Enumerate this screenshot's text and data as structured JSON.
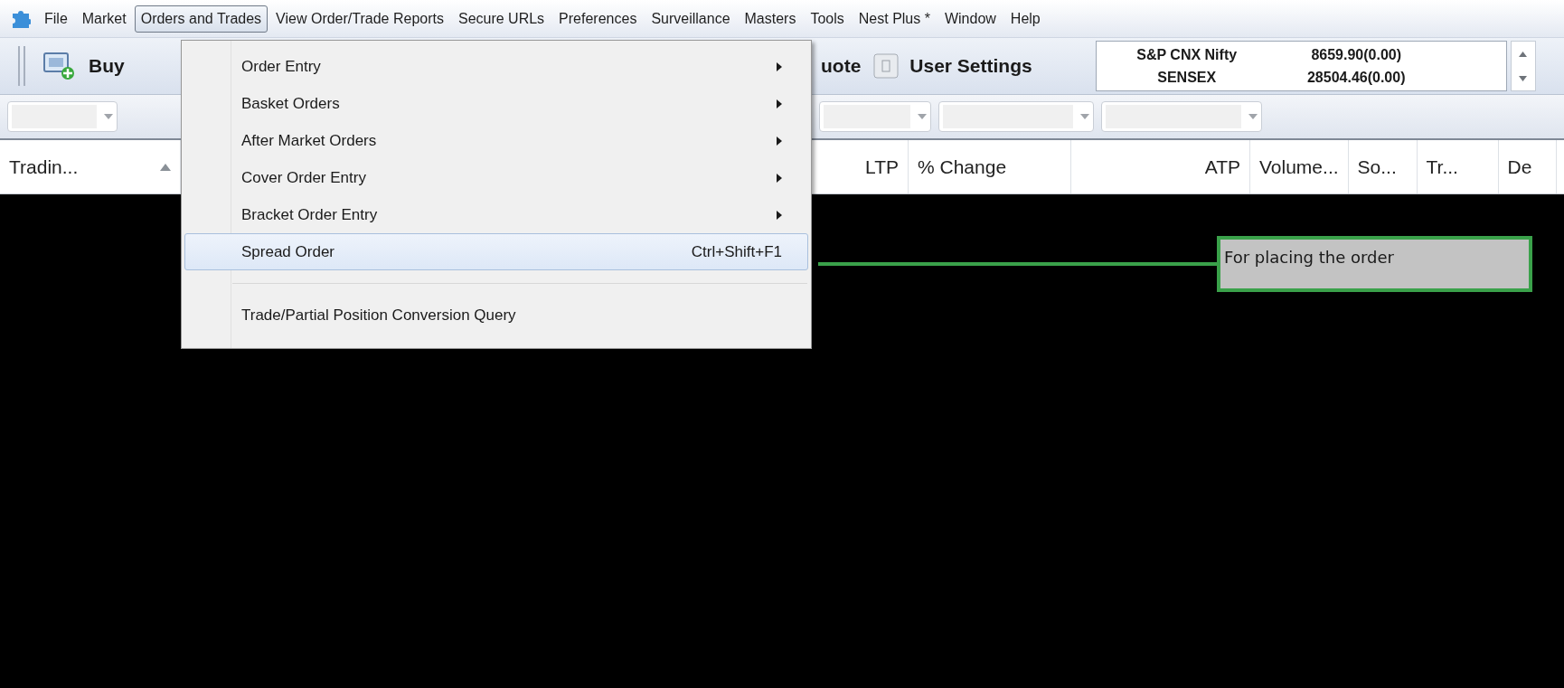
{
  "menu_bar": {
    "items": [
      {
        "label": "File",
        "selected": false
      },
      {
        "label": "Market",
        "selected": false
      },
      {
        "label": "Orders and Trades",
        "selected": true
      },
      {
        "label": "View Order/Trade Reports",
        "selected": false
      },
      {
        "label": "Secure URLs",
        "selected": false
      },
      {
        "label": "Preferences",
        "selected": false
      },
      {
        "label": "Surveillance",
        "selected": false
      },
      {
        "label": "Masters",
        "selected": false
      },
      {
        "label": "Tools",
        "selected": false
      },
      {
        "label": "Nest Plus *",
        "selected": false
      },
      {
        "label": "Window",
        "selected": false
      },
      {
        "label": "Help",
        "selected": false
      }
    ]
  },
  "toolbar": {
    "buy_label": "Buy",
    "quote_label": "uote",
    "settings_label": "User Settings"
  },
  "index_ticker": {
    "rows": [
      {
        "name": "S&P CNX Nifty",
        "value": "8659.90(0.00)"
      },
      {
        "name": "SENSEX",
        "value": "28504.46(0.00)"
      }
    ]
  },
  "market_watch": {
    "columns": [
      {
        "label": "Tradin...",
        "sorted": true,
        "kind": "text"
      },
      {
        "label": "LTP",
        "sorted": false,
        "kind": "numeric"
      },
      {
        "label": "% Change",
        "sorted": false,
        "kind": "text"
      },
      {
        "label": "ATP",
        "sorted": false,
        "kind": "numeric"
      },
      {
        "label": "Volume...",
        "sorted": false,
        "kind": "text"
      },
      {
        "label": "So...",
        "sorted": false,
        "kind": "text"
      },
      {
        "label": "Tr...",
        "sorted": false,
        "kind": "text"
      },
      {
        "label": "De",
        "sorted": false,
        "kind": "text"
      }
    ]
  },
  "dropdown_menu": {
    "items": [
      {
        "kind": "submenu",
        "label": "Order Entry",
        "selected": false
      },
      {
        "kind": "submenu",
        "label": "Basket Orders",
        "selected": false
      },
      {
        "kind": "submenu",
        "label": "After Market Orders",
        "selected": false
      },
      {
        "kind": "submenu",
        "label": "Cover Order Entry",
        "selected": false
      },
      {
        "kind": "submenu",
        "label": "Bracket Order Entry",
        "selected": false
      },
      {
        "kind": "shortcut",
        "label": "Spread Order",
        "shortcut": "Ctrl+Shift+F1",
        "selected": true
      },
      {
        "kind": "separator"
      },
      {
        "kind": "plain",
        "label": "Trade/Partial Position Conversion Query",
        "selected": false
      }
    ]
  },
  "callout": {
    "text": "For placing the order"
  }
}
